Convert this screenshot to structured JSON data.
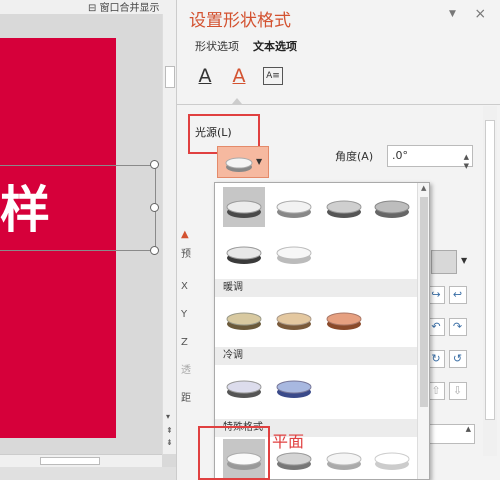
{
  "window": {
    "merge_display_label": "窗口合并显示"
  },
  "slide": {
    "text": "样"
  },
  "panel": {
    "title": "设置形状格式",
    "tabs": [
      "形状选项",
      "文本选项"
    ],
    "icons": [
      "text-fill-icon",
      "text-effects-icon",
      "textbox-icon"
    ],
    "icon_glyphs": {
      "fill": "A",
      "effects": "A",
      "textbox": "A≡"
    },
    "light_source_label": "光源(L)",
    "angle_label": "角度(A)",
    "angle_value": ".0°",
    "partial_labels": [
      "预",
      "X",
      "Y",
      "Z",
      "透",
      "距"
    ],
    "close_glyph": "×",
    "dropdown_glyph": "▼"
  },
  "gallery": {
    "sections": [
      "暖调",
      "冷调",
      "特殊格式"
    ],
    "annotation": "平面"
  },
  "colors": {
    "accent": "#d35230",
    "highlight_red": "#e04040",
    "slide_red": "#d6003a"
  }
}
